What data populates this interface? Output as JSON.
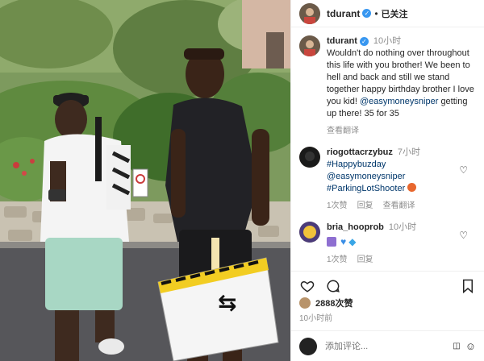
{
  "post": {
    "author": "tdurant",
    "follow_status": "已关注",
    "caption": {
      "author": "tdurant",
      "time": "10小时",
      "text": "Wouldn't do nothing over throughout this life with you brother! We been to hell and back and still we stand together happy birthday brother I love you kid!",
      "mention": "@easymoneysniper",
      "text_after_mention": "getting up there! 35 for 35",
      "see_translation": "查看翻译"
    }
  },
  "comments": [
    {
      "user": "riogottacrzybuz",
      "time": "7小时",
      "lines": [
        "#Happybuzday",
        "@easymoneysniper",
        "#ParkingLotShooter"
      ],
      "likes": "1次赞",
      "reply": "回复",
      "see_translation": "查看翻译"
    },
    {
      "user": "bria_hooprob",
      "time": "10小时",
      "likes": "1次赞",
      "reply": "回复"
    }
  ],
  "actions": {
    "like_icon": "heart-icon",
    "comment_icon": "comment-icon",
    "save_icon": "bookmark-icon"
  },
  "likes_count": "2888次赞",
  "posted_time": "10小时前",
  "add_comment": {
    "placeholder": "添加评论..."
  },
  "colors": {
    "verified": "#3897f0",
    "mention": "#00376b",
    "muted": "#8e8e8e"
  }
}
